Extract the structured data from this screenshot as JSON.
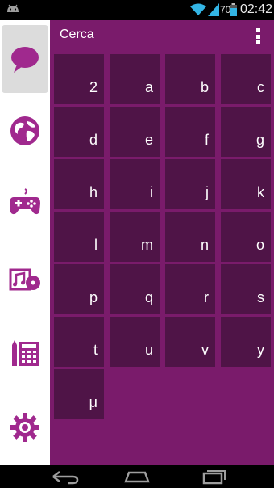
{
  "status_bar": {
    "battery": "70",
    "time": "02:42"
  },
  "sidebar": {
    "items": [
      {
        "name": "chat",
        "icon": "speech-bubble-icon",
        "active": true
      },
      {
        "name": "globe",
        "icon": "globe-icon",
        "active": false
      },
      {
        "name": "games",
        "icon": "gamepad-icon",
        "active": false
      },
      {
        "name": "media",
        "icon": "music-media-icon",
        "active": false
      },
      {
        "name": "tools",
        "icon": "calculator-icon",
        "active": false
      },
      {
        "name": "settings",
        "icon": "gear-icon",
        "active": false
      }
    ]
  },
  "header": {
    "title": "Cerca"
  },
  "keys": [
    "2",
    "a",
    "b",
    "c",
    "d",
    "e",
    "f",
    "g",
    "h",
    "i",
    "j",
    "k",
    "l",
    "m",
    "n",
    "o",
    "p",
    "q",
    "r",
    "s",
    "t",
    "u",
    "v",
    "y",
    "μ"
  ],
  "colors": {
    "main_bg": "#7a1b6b",
    "tile_bg": "#4f1447",
    "icon_accent": "#a0298e"
  }
}
